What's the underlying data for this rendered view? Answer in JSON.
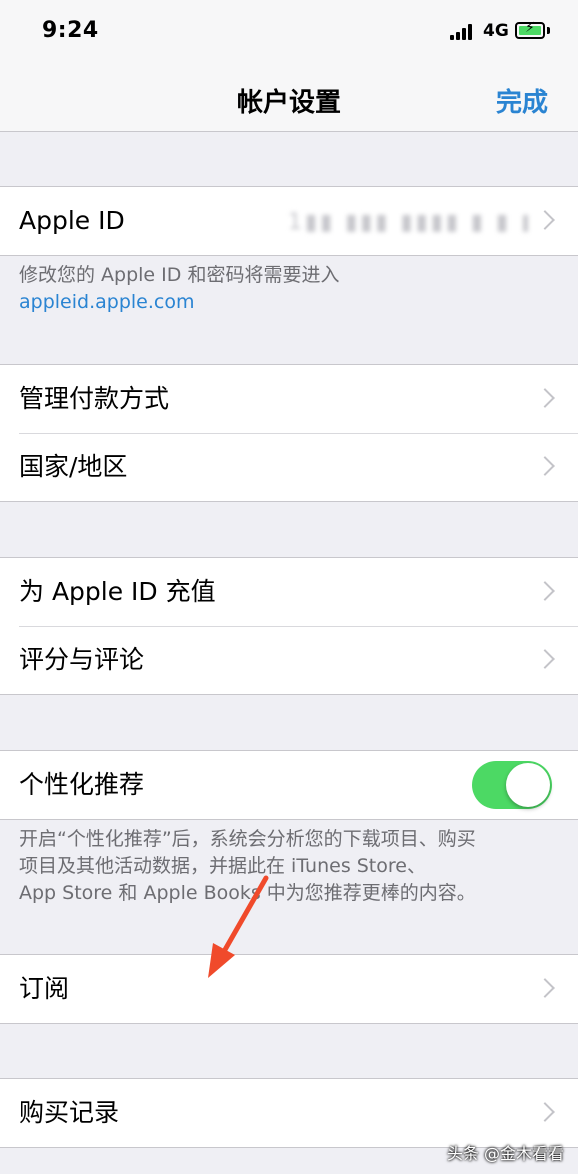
{
  "status_bar": {
    "time": "9:24",
    "network": "4G",
    "battery_color": "#4cd964"
  },
  "nav": {
    "title": "帐户设置",
    "done_label": "完成"
  },
  "apple_id": {
    "label": "Apple ID",
    "value": "1▮▮ ▮▮▮ ▮▮▮▮ ▮ ▮ ▮ ▮",
    "footer_text": "修改您的 Apple ID 和密码将需要进入",
    "footer_link": "appleid.apple.com"
  },
  "group_payment": {
    "items": [
      {
        "label": "管理付款方式"
      },
      {
        "label": "国家/地区"
      }
    ]
  },
  "group_topup": {
    "items": [
      {
        "label": "为 Apple ID 充值"
      },
      {
        "label": "评分与评论"
      }
    ]
  },
  "personalized": {
    "label": "个性化推荐",
    "toggle_on": true,
    "footer_lines": [
      "开启“个性化推荐”后，系统会分析您的下载项目、购买",
      "项目及其他活动数据，并据此在 iTunes Store、",
      "App Store 和 Apple Books 中为您推荐更棒的内容。"
    ]
  },
  "subscriptions": {
    "label": "订阅"
  },
  "purchase_history": {
    "label": "购买记录"
  },
  "watermark": "头条 @金木看看",
  "colors": {
    "accent": "#2a84d2",
    "toggle_on": "#4cd964",
    "annotation_arrow": "#f04a2b"
  }
}
